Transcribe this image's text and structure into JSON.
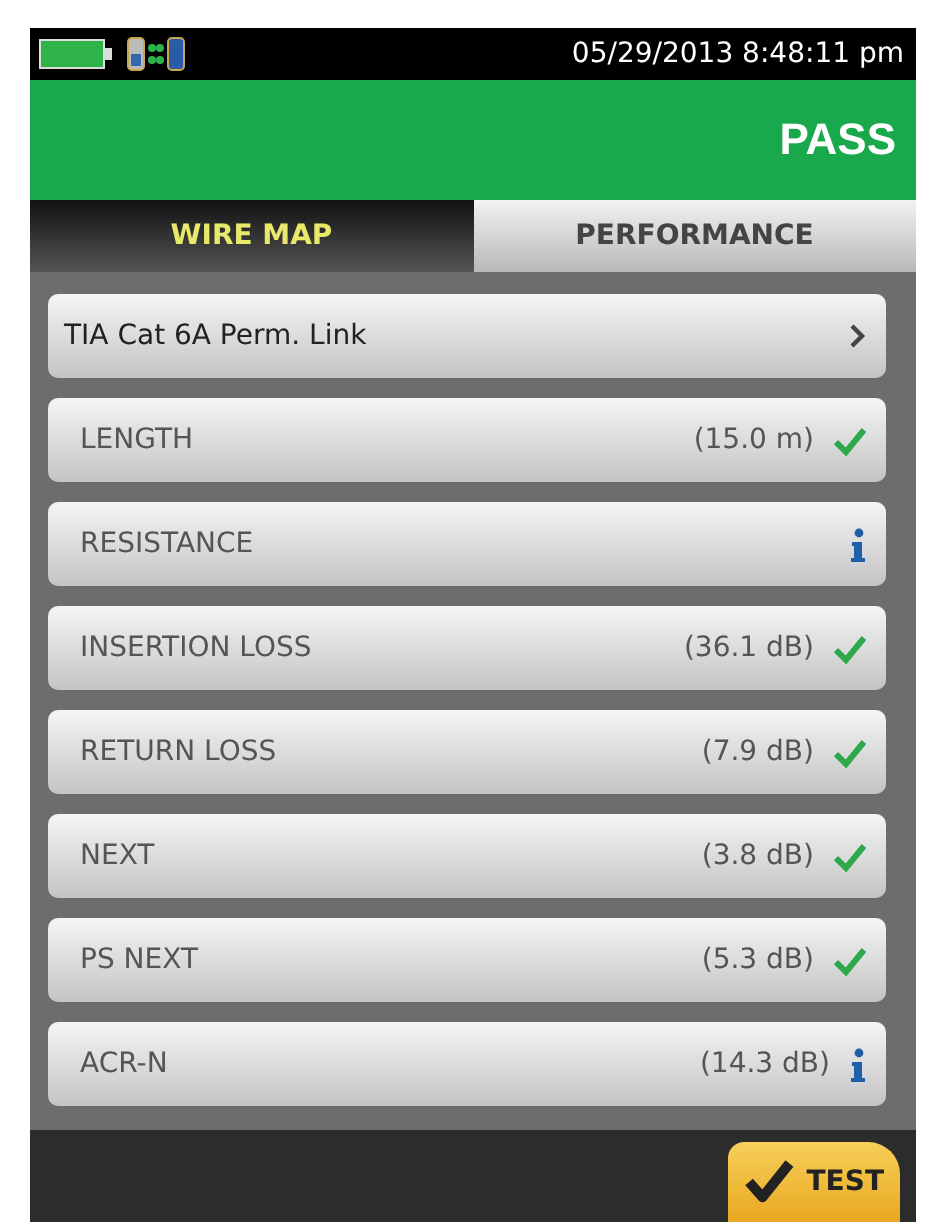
{
  "status_bar": {
    "datetime": "05/29/2013 8:48:11 pm"
  },
  "header": {
    "result": "PASS"
  },
  "tabs": [
    {
      "label": "WIRE MAP",
      "selected": true
    },
    {
      "label": "PERFORMANCE",
      "selected": false
    }
  ],
  "rows": [
    {
      "kind": "link",
      "label": "TIA Cat 6A Perm. Link"
    },
    {
      "kind": "pass",
      "label": "LENGTH",
      "value": "(15.0 m)"
    },
    {
      "kind": "info",
      "label": "RESISTANCE"
    },
    {
      "kind": "pass",
      "label": "INSERTION LOSS",
      "value": "(36.1 dB)"
    },
    {
      "kind": "pass",
      "label": "RETURN LOSS",
      "value": "(7.9 dB)"
    },
    {
      "kind": "pass",
      "label": "NEXT",
      "value": "(3.8 dB)"
    },
    {
      "kind": "pass",
      "label": "PS NEXT",
      "value": "(5.3 dB)"
    },
    {
      "kind": "info",
      "label": "ACR-N",
      "value": "(14.3 dB)"
    }
  ],
  "test_button": {
    "label": "TEST"
  }
}
